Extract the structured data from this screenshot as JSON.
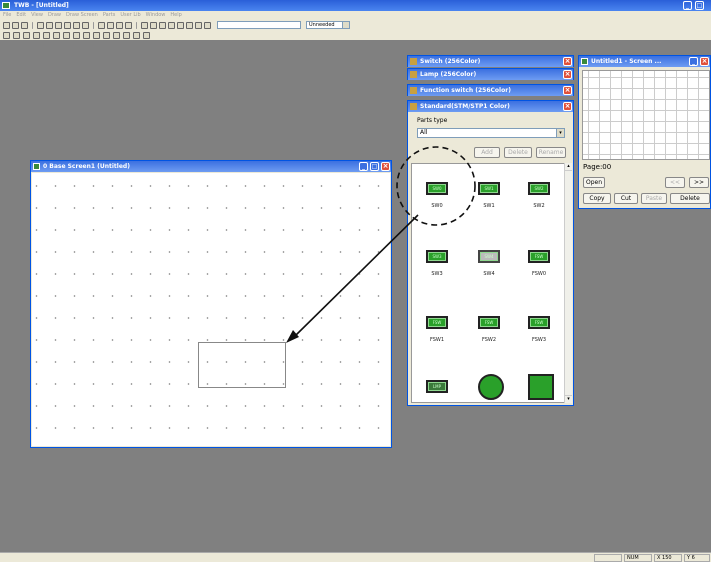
{
  "app": {
    "title": "TWB - [Untitled]",
    "title_buttons": [
      "_",
      "□"
    ]
  },
  "menu": [
    "File",
    "Edit",
    "View",
    "Draw",
    "Draw Screen",
    "Parts",
    "User Lib",
    "Window",
    "Help"
  ],
  "toolbar": {
    "font_size_value": "",
    "unit_select": "Unneeded"
  },
  "status": {
    "mode": "NUM",
    "x": "X 150",
    "y": "Y 6"
  },
  "screen_window": {
    "title": "0 Base Screen1 (Untitled)"
  },
  "panels": {
    "switch": "Switch (256Color)",
    "lamp": "Lamp (256Color)",
    "function_switch": "Function switch (256Color)",
    "standard": "Standard(STM/STP1 Color)"
  },
  "parts_panel": {
    "parts_type_label": "Parts type",
    "parts_type_value": "All",
    "add_btn": "Add",
    "delete_btn": "Delete",
    "rename_btn": "Rename",
    "items": [
      {
        "label": "SW0",
        "cap": "SW0"
      },
      {
        "label": "SW1",
        "cap": "SW1"
      },
      {
        "label": "SW2",
        "cap": "SW2"
      },
      {
        "label": "SW3",
        "cap": "SW3"
      },
      {
        "label": "SW4",
        "cap": "SW4"
      },
      {
        "label": "FSW0",
        "cap": "FSW"
      },
      {
        "label": "FSW1",
        "cap": "FSW"
      },
      {
        "label": "FSW2",
        "cap": "FSW"
      },
      {
        "label": "FSW3",
        "cap": "FSW"
      },
      {
        "label": "",
        "cap": "LMP"
      },
      {
        "label": "",
        "cap": ""
      },
      {
        "label": "",
        "cap": ""
      }
    ]
  },
  "screen_list": {
    "title": "Untitled1 - Screen ...",
    "page_label": "Page:00",
    "open_btn": "Open",
    "prev_btn": "<<",
    "next_btn": ">>",
    "copy_btn": "Copy",
    "cut_btn": "Cut",
    "paste_btn": "Paste",
    "delete_btn": "Delete"
  }
}
